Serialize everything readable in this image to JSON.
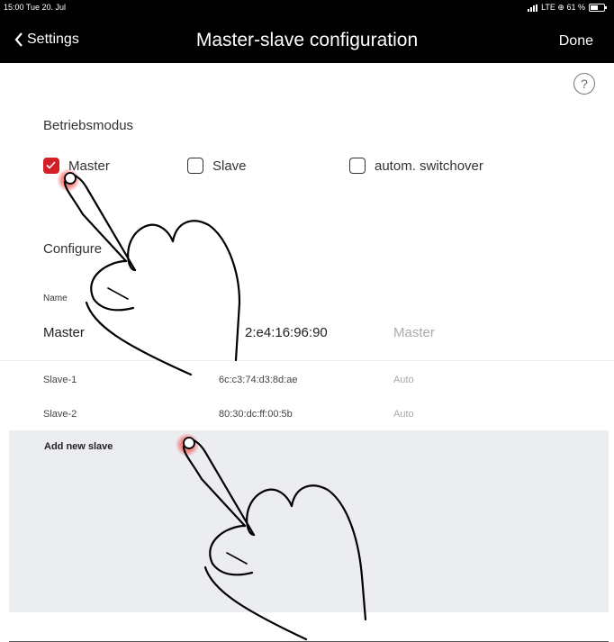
{
  "status_bar": {
    "time": "15:00  Tue 20. Jul",
    "indicators": "LTE ⊕ 61 %",
    "battery_level": 0.61
  },
  "nav": {
    "back_label": "Settings",
    "title": "Master-slave configuration",
    "done_label": "Done"
  },
  "help_icon": "?",
  "mode": {
    "heading": "Betriebsmodus",
    "options": [
      {
        "label": "Master",
        "checked": true
      },
      {
        "label": "Slave",
        "checked": false
      },
      {
        "label": "autom. switchover",
        "checked": false
      }
    ]
  },
  "configure": {
    "heading": "Configure",
    "name_label": "Name",
    "master": {
      "name": "Master",
      "mac": "2:e4:16:96:90",
      "mode": "Master"
    },
    "slaves": [
      {
        "name": "Slave-1",
        "mac": "6c:c3:74:d3:8d:ae",
        "mode": "Auto"
      },
      {
        "name": "Slave-2",
        "mac": "80:30:dc:ff:00:5b",
        "mode": "Auto"
      }
    ],
    "add_label": "Add new slave"
  },
  "colors": {
    "accent": "#d32027",
    "navbar": "#000000",
    "panel": "#ecedf1"
  }
}
